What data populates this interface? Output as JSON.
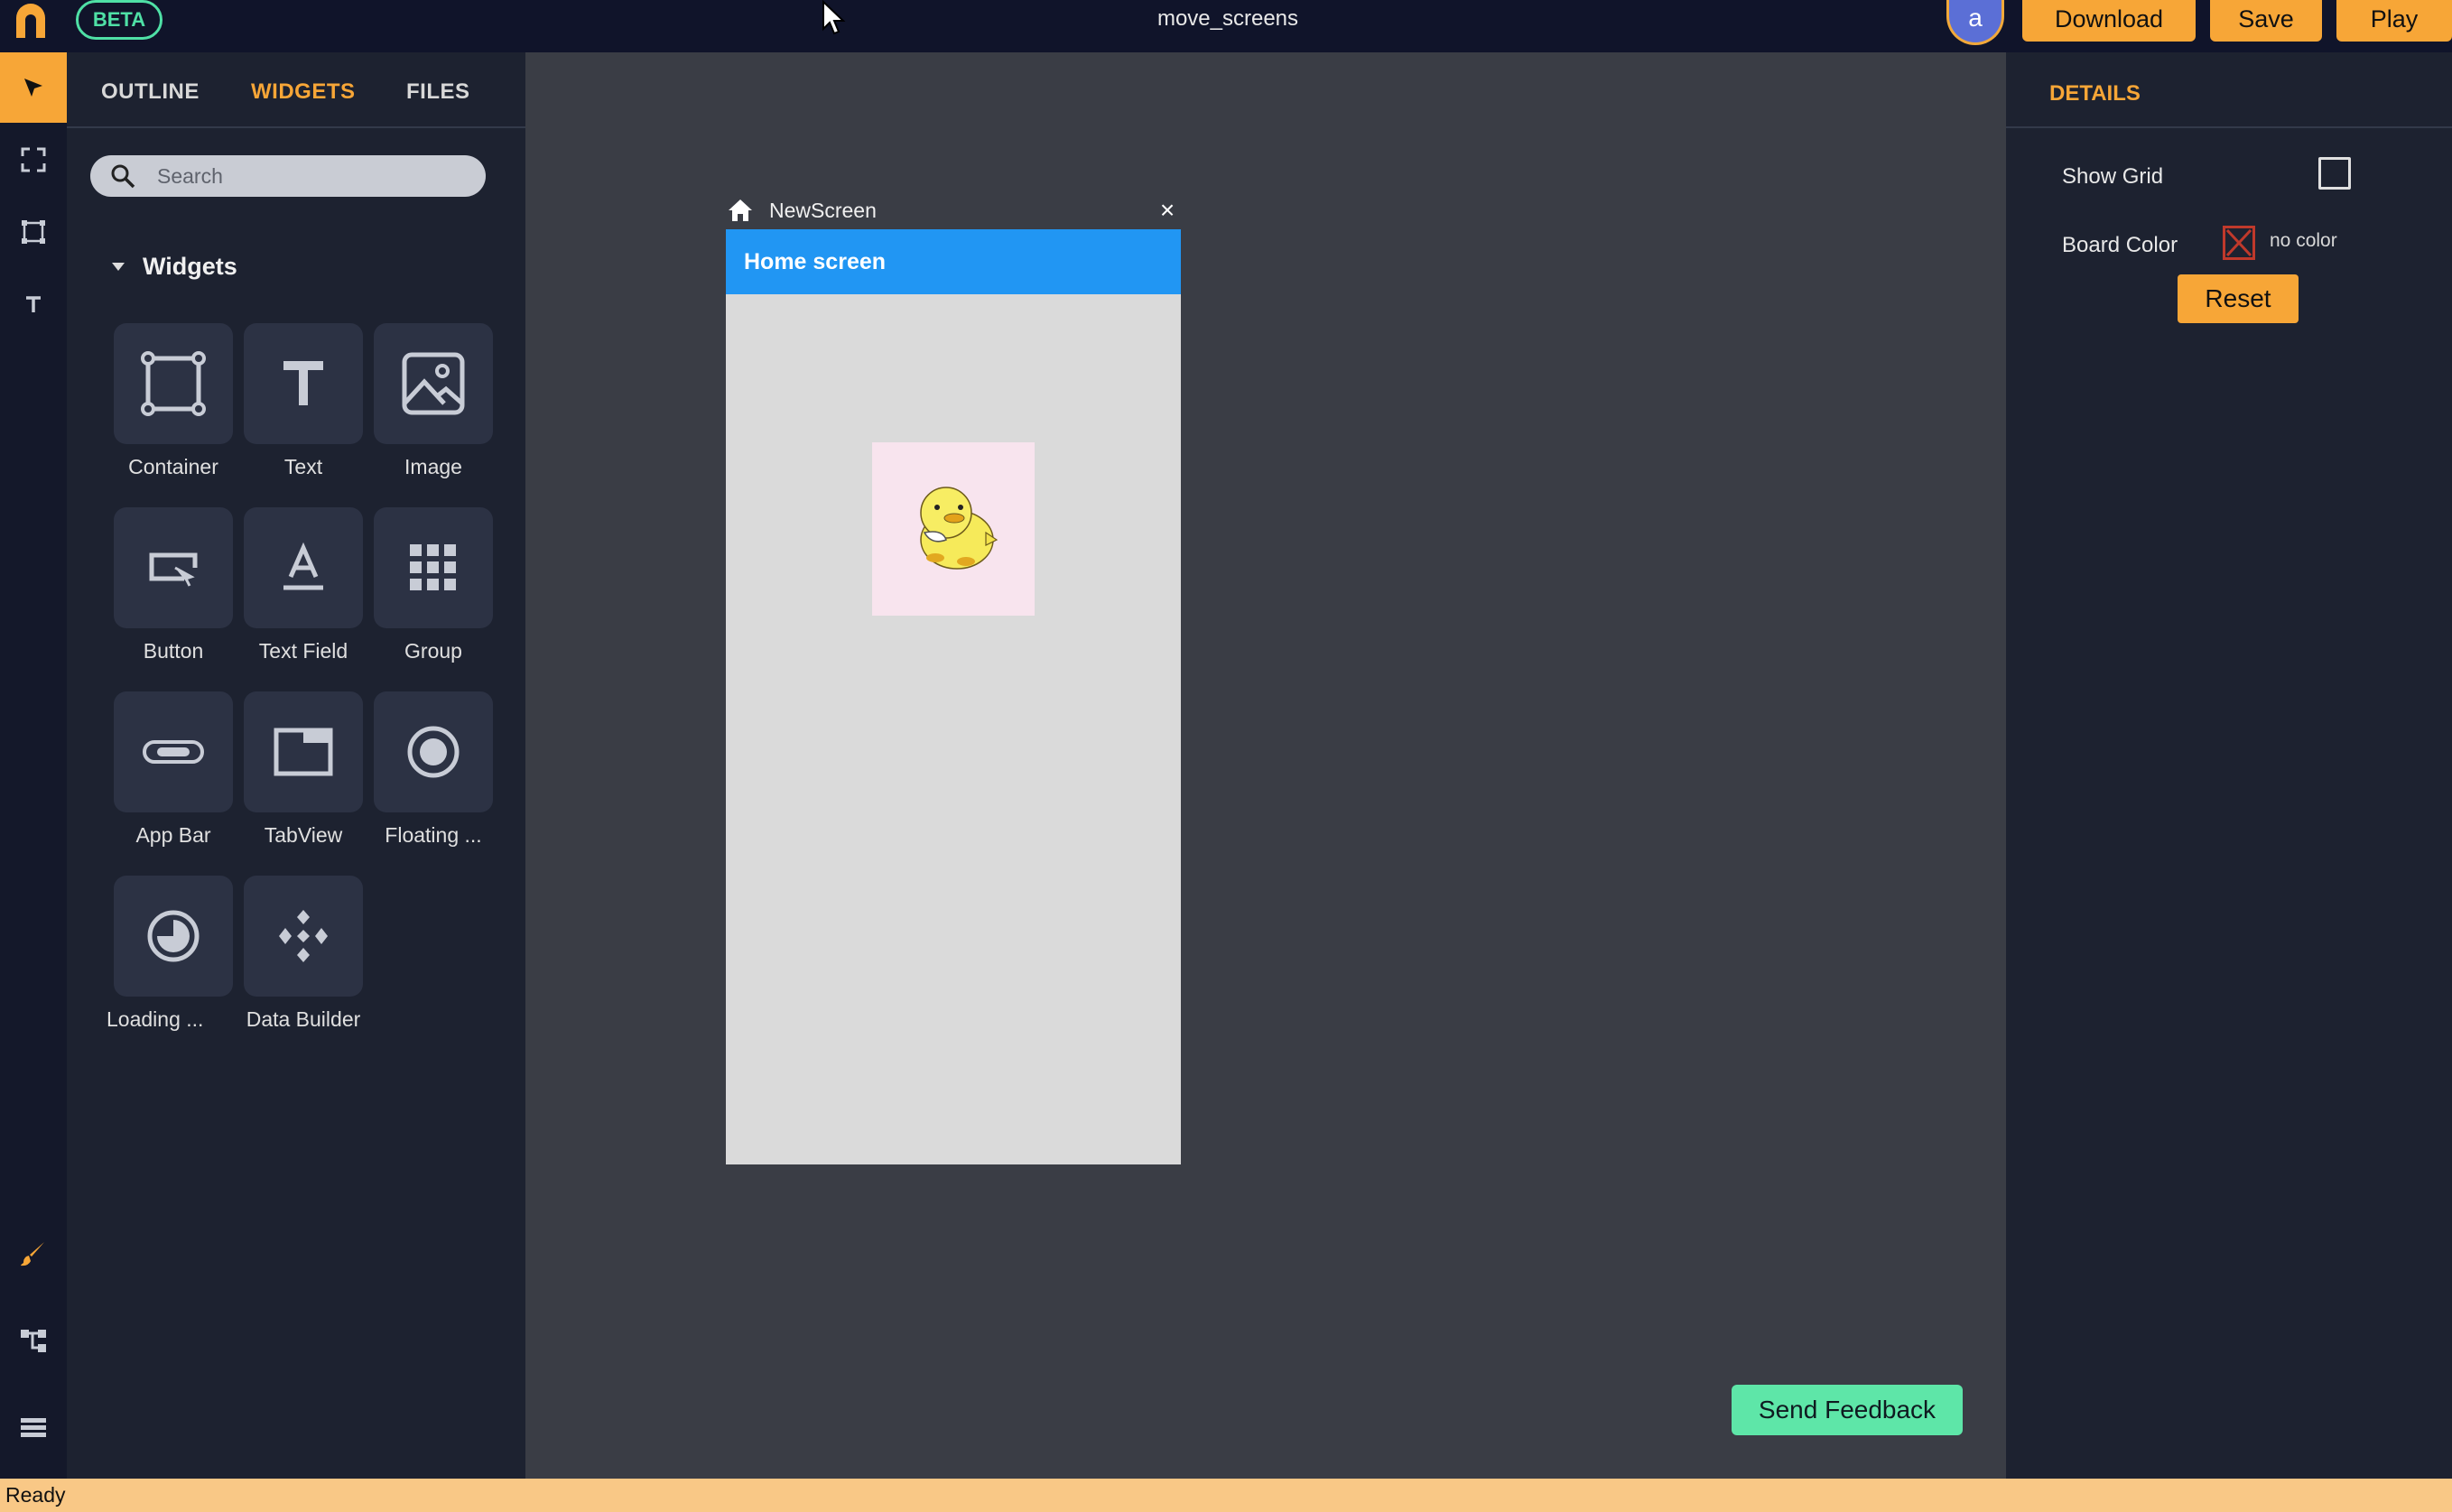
{
  "topbar": {
    "beta_label": "BETA",
    "project_title": "move_screens",
    "avatar_letter": "a",
    "download_label": "Download",
    "save_label": "Save",
    "play_label": "Play"
  },
  "left_tools": [
    "select-icon",
    "fullscreen-icon",
    "container-tool-icon",
    "text-tool-icon",
    "brush-icon",
    "tree-icon",
    "list-icon"
  ],
  "panel": {
    "tabs": [
      {
        "label": "OUTLINE",
        "active": false
      },
      {
        "label": "WIDGETS",
        "active": true
      },
      {
        "label": "FILES",
        "active": false
      }
    ],
    "search": {
      "placeholder": "Search",
      "value": ""
    },
    "section_title": "Widgets",
    "widgets": [
      {
        "label": "Container",
        "icon": "container-icon"
      },
      {
        "label": "Text",
        "icon": "text-icon"
      },
      {
        "label": "Image",
        "icon": "image-icon"
      },
      {
        "label": "Button",
        "icon": "button-icon"
      },
      {
        "label": "Text Field",
        "icon": "text-field-icon"
      },
      {
        "label": "Group",
        "icon": "grid-icon"
      },
      {
        "label": "App Bar",
        "icon": "app-bar-icon"
      },
      {
        "label": "TabView",
        "icon": "tab-view-icon"
      },
      {
        "label": "Floating ...",
        "icon": "radio-icon"
      },
      {
        "label": "Loading ...",
        "icon": "loading-icon"
      },
      {
        "label": "Data Builder",
        "icon": "data-builder-icon"
      }
    ]
  },
  "canvas": {
    "screen_name": "NewScreen",
    "close_symbol": "×",
    "appbar_title": "Home screen",
    "feedback_label": "Send Feedback"
  },
  "details": {
    "tab_label": "DETAILS",
    "show_grid_label": "Show Grid",
    "show_grid_checked": false,
    "board_color_label": "Board Color",
    "board_color_value": "no color",
    "reset_label": "Reset"
  },
  "status": {
    "text": "Ready"
  },
  "colors": {
    "accent": "#f7a637",
    "beta": "#4fe0a6",
    "appbar": "#2196f3",
    "feedback": "#5ee6a8",
    "status_bar": "#f9c886"
  }
}
